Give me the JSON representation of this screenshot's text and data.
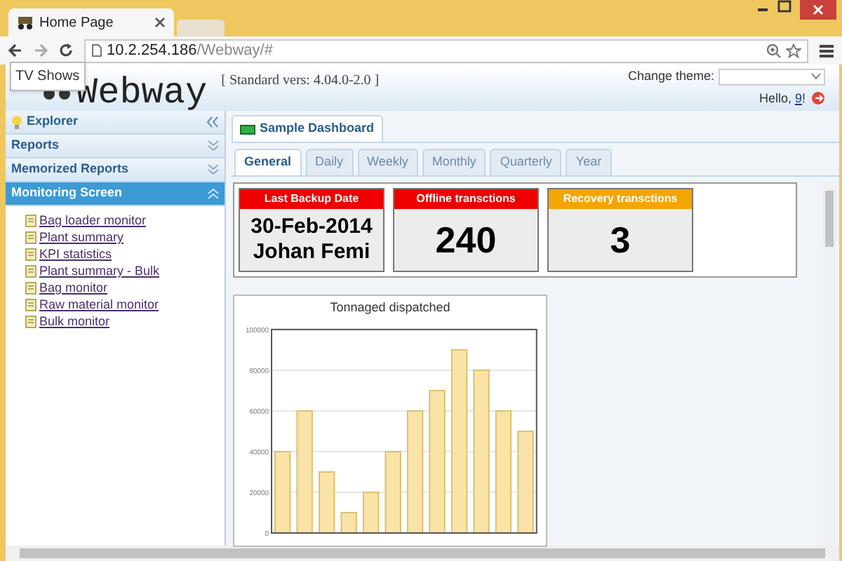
{
  "browser": {
    "tab_title": "Home Page",
    "address_host": "10.2.254.186",
    "address_path": "/Webway/#",
    "tooltip": "TV Shows"
  },
  "header": {
    "logo": "Webway",
    "version": "[ Standard vers: 4.04.0-2.0 ]",
    "theme_label": "Change theme:",
    "greeting": "Hello,",
    "user": "9",
    "greeting_end": "!"
  },
  "sidebar": {
    "sections": [
      {
        "label": "Explorer",
        "kind": "explorer",
        "selected": false
      },
      {
        "label": "Reports",
        "kind": "section",
        "selected": false
      },
      {
        "label": "Memorized Reports",
        "kind": "section",
        "selected": false
      },
      {
        "label": "Monitoring Screen",
        "kind": "section",
        "selected": true,
        "items": [
          "Bag loader monitor",
          "Plant summary",
          "KPI statistics",
          "Plant summary - Bulk",
          "Bag monitor",
          "Raw material monitor",
          "Bulk monitor"
        ]
      }
    ]
  },
  "dashboard_tab": "Sample Dashboard",
  "tabs": [
    {
      "label": "General",
      "selected": true
    },
    {
      "label": "Daily",
      "selected": false
    },
    {
      "label": "Weekly",
      "selected": false
    },
    {
      "label": "Monthly",
      "selected": false
    },
    {
      "label": "Quarterly",
      "selected": false
    },
    {
      "label": "Year",
      "selected": false
    }
  ],
  "cards": [
    {
      "title": "Last Backup Date",
      "color": "#ee0000",
      "lines": [
        "30-Feb-2014",
        "Johan Femi"
      ]
    },
    {
      "title": "Offline transctions",
      "color": "#ee0000",
      "lines": [
        "240"
      ]
    },
    {
      "title": "Recovery transctions",
      "color": "#f5a500",
      "lines": [
        "3"
      ]
    }
  ],
  "chart_data": {
    "type": "bar",
    "grid": true,
    "title": "Tonnaged dispatched",
    "ylim": [
      0,
      100000
    ],
    "yticks": [
      0,
      20000,
      40000,
      60000,
      80000,
      100000
    ],
    "values": [
      40000,
      60000,
      30000,
      10000,
      20000,
      40000,
      60000,
      70000,
      90000,
      80000,
      60000,
      50000
    ]
  }
}
